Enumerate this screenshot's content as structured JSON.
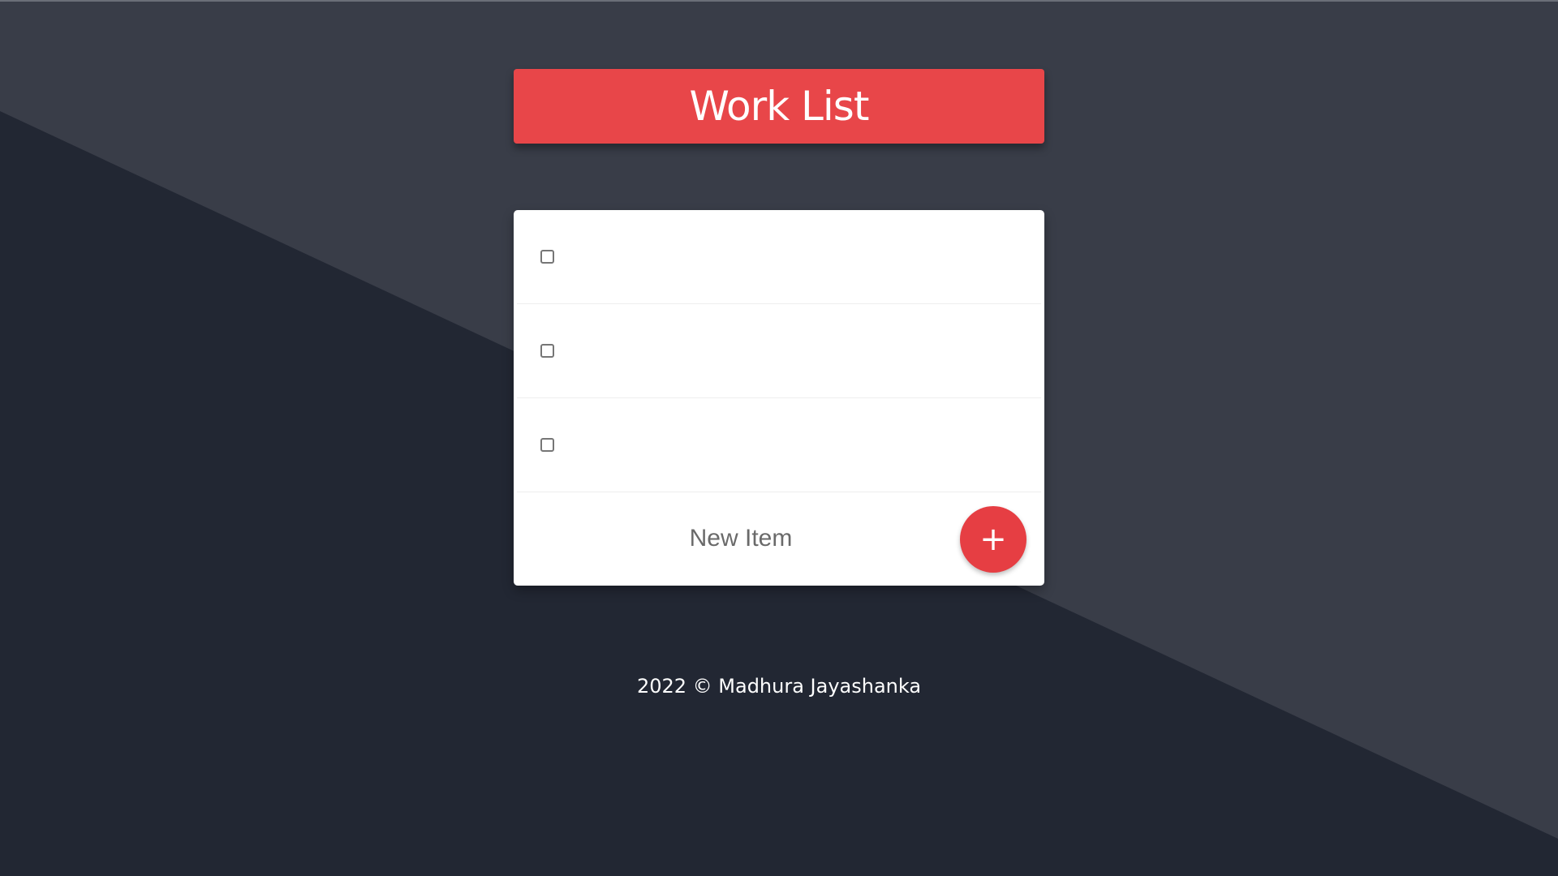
{
  "header": {
    "title": "Work List"
  },
  "items": [
    {
      "label": "",
      "checked": false
    },
    {
      "label": "",
      "checked": false
    },
    {
      "label": "",
      "checked": false
    }
  ],
  "new_item": {
    "placeholder": "New Item",
    "value": "",
    "add_label": "+"
  },
  "footer": {
    "text": "2022 © Madhura Jayashanka"
  },
  "colors": {
    "accent": "#e84649",
    "background_light": "#393d48",
    "background_dark": "#222733",
    "card": "#ffffff"
  }
}
